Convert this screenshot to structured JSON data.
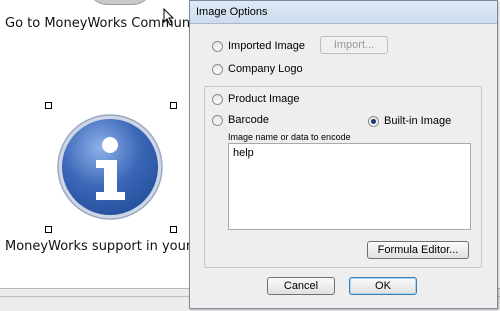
{
  "background": {
    "community_link": "Go to MoneyWorks Community",
    "support_caption": "MoneyWorks support in your co",
    "info_glyph": "i"
  },
  "dialog": {
    "title": "Image Options",
    "options": {
      "imported_image": "Imported Image",
      "company_logo": "Company Logo",
      "product_image": "Product Image",
      "barcode": "Barcode",
      "builtin_image": "Built-in Image"
    },
    "selected": "builtin_image",
    "import_button": "Import...",
    "encode_label": "Image name or data to encode",
    "encode_value": "help",
    "formula_editor_button": "Formula Editor...",
    "cancel_button": "Cancel",
    "ok_button": "OK"
  },
  "colors": {
    "info_icon_blue": "#3b67b7",
    "dialog_bg": "#eeeeee",
    "radio_dot": "#1b3a6e"
  }
}
